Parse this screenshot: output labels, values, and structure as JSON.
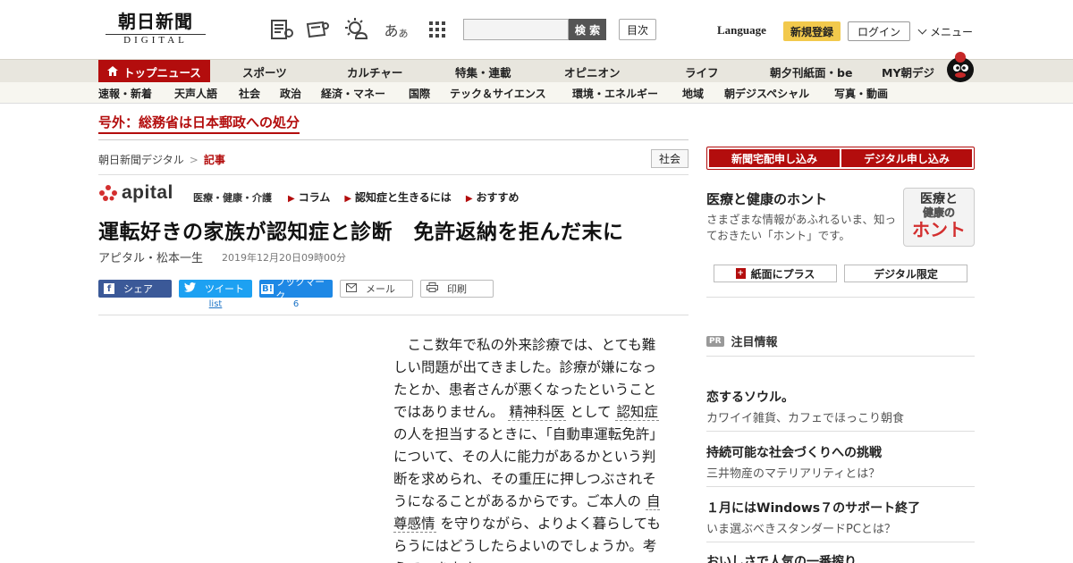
{
  "header": {
    "logo_jp": "朝日新聞",
    "logo_en": "DIGITAL",
    "icons": [
      "newspaper-icon",
      "reading-icon",
      "weather-icon",
      "font-size-icon",
      "grid-icon"
    ],
    "font_size_glyph": "あ",
    "font_size_glyph_small": "あ",
    "search_placeholder": "",
    "search_button": "検 索",
    "toc_button": "目次",
    "language": "Language",
    "register": "新規登録",
    "login": "ログイン",
    "menu": "メニュー"
  },
  "nav1": [
    "トップニュース",
    "スポーツ",
    "カルチャー",
    "特集・連載",
    "オピニオン",
    "ライフ",
    "朝夕刊紙面・be",
    "MY朝デジ"
  ],
  "nav2": [
    "速報・新着",
    "天声人語",
    "社会",
    "政治",
    "経済・マネー",
    "国際",
    "テック＆サイエンス",
    "環境・エネルギー",
    "地域",
    "朝デジスペシャル",
    "写真・動画"
  ],
  "breaking": "号外：総務省は日本郵政への処分",
  "breadcrumb": {
    "home": "朝日新聞デジタル",
    "current": "記事"
  },
  "category_tag": "社会",
  "apital": {
    "logo": "apital",
    "sub": "医療・健康・介護",
    "links": [
      "コラム",
      "認知症と生きるには",
      "おすすめ"
    ]
  },
  "article": {
    "headline": "運転好きの家族が認知症と診断　免許返納を拒んだ末に",
    "author": "アピタル・松本一生",
    "date": "2019年12月20日09時00分",
    "body_1": "ここ数年で私の外来診療では、とても難しい問題が出てきました。診療が嫌になったとか、患者さんが悪くなったということではありません。",
    "kw_1": "精神科医",
    "body_2": "として",
    "kw_2": "認知症",
    "body_3": "の人を担当するときに、「自動車運転免許」について、その人に能力があるかという判断を求められ、その重圧に押しつぶされそうになることがあるからです。ご本人の",
    "kw_3": "自尊感情",
    "body_4": "を守りながら、よりよく暮らしてもらうにはどうしたらよいのでしょうか。考えていきます。"
  },
  "share": {
    "facebook": "シェア",
    "twitter": "ツイート",
    "hatena": "ブックマーク",
    "mail": "メール",
    "print": "印刷",
    "twitter_count": "list",
    "hatena_count": "6"
  },
  "sidebar": {
    "subscribe_paper": "新聞宅配申し込み",
    "subscribe_digital": "デジタル申し込み",
    "honto_title": "医療と健康のホント",
    "honto_desc": "さまざまな情報があふれるいま、知っておきたい「ホント」です。",
    "honto_logo_1": "医療と",
    "honto_logo_2": "健康の",
    "honto_logo_3": "ホント",
    "paper_plus": "紙面にプラス",
    "digital_only": "デジタル限定",
    "pr_badge": "PR",
    "pr_label": "注目情報",
    "ads": [
      {
        "title": "恋するソウル。",
        "sub": "カワイイ雑貨、カフェでほっこり朝食"
      },
      {
        "title": "持続可能な社会づくりへの挑戦",
        "sub": "三井物産のマテリアリティとは？"
      },
      {
        "title": "１月にはWindows７のサポート終了",
        "sub": "いま選ぶべきスタンダードPCとは？"
      },
      {
        "title": "おいしさで人気の一番搾り",
        "sub": ""
      }
    ]
  },
  "colors": {
    "brand_red": "#b30d0d",
    "register_yellow": "#f2c94c",
    "facebook": "#3b5998",
    "twitter": "#1da1f2",
    "hatena": "#1e88e5"
  }
}
